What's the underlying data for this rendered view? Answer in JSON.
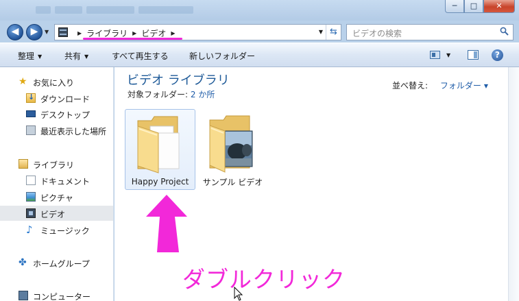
{
  "window": {
    "minimize_glyph": "─",
    "maximize_glyph": "□",
    "close_glyph": "✕"
  },
  "navigation": {
    "back_glyph": "◀",
    "forward_glyph": "▶",
    "dropdown_glyph": "▼",
    "address": {
      "icon": "video-library-icon",
      "separator_glyph": "▶",
      "breadcrumbs": [
        "ライブラリ",
        "ビデオ"
      ],
      "dropdown_glyph": "▼",
      "refresh_glyph": "⇆"
    },
    "search": {
      "placeholder": "ビデオの検索",
      "icon": "search-icon"
    }
  },
  "toolbar": {
    "organize": "整理",
    "share": "共有",
    "play_all": "すべて再生する",
    "new_folder": "新しいフォルダー",
    "dropdown_glyph": "▼",
    "help_glyph": "?"
  },
  "sidebar": {
    "favorites": {
      "label": "お気に入り",
      "icon": "star-icon",
      "items": [
        {
          "label": "ダウンロード",
          "icon": "downloads-folder-icon"
        },
        {
          "label": "デスクトップ",
          "icon": "desktop-icon"
        },
        {
          "label": "最近表示した場所",
          "icon": "recent-places-icon"
        }
      ]
    },
    "libraries": {
      "label": "ライブラリ",
      "icon": "library-icon",
      "items": [
        {
          "label": "ドキュメント",
          "icon": "documents-icon"
        },
        {
          "label": "ピクチャ",
          "icon": "pictures-icon"
        },
        {
          "label": "ビデオ",
          "icon": "videos-icon",
          "selected": true
        },
        {
          "label": "ミュージック",
          "icon": "music-icon"
        }
      ]
    },
    "homegroup": {
      "label": "ホームグループ",
      "icon": "homegroup-icon"
    },
    "computer": {
      "label": "コンピューター",
      "icon": "computer-icon"
    }
  },
  "content": {
    "title": "ビデオ ライブラリ",
    "subtitle_prefix": "対象フォルダー:",
    "subtitle_link": "2 か所",
    "sort_label": "並べ替え:",
    "sort_value": "フォルダー",
    "sort_arrow": "▼",
    "items": [
      {
        "label": "Happy Project",
        "icon": "folder-icon",
        "selected": true
      },
      {
        "label": "サンプル ビデオ",
        "icon": "folder-with-image-icon",
        "selected": false
      }
    ]
  },
  "annotation": {
    "instruction": "ダブルクリック",
    "color": "#f228d9"
  }
}
